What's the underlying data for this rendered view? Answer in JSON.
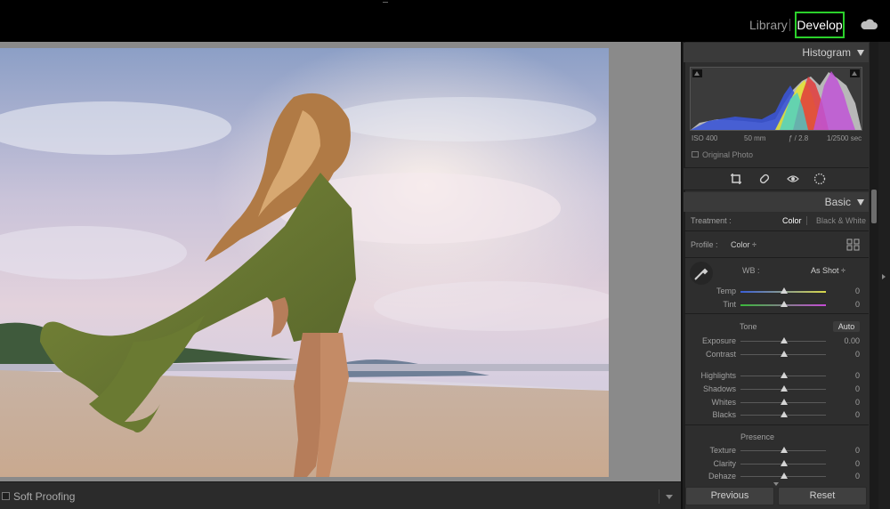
{
  "modules": {
    "library": "Library",
    "develop": "Develop"
  },
  "icons": {
    "cloud": "cloud-icon",
    "crop": "crop-overlay-icon",
    "heal": "healing-brush-icon",
    "redeye": "red-eye-icon",
    "masking": "masking-icon",
    "eyedropper": "eyedropper-icon",
    "profile_browser": "profile-browser-grid-icon"
  },
  "histogram": {
    "title": "Histogram",
    "iso": "ISO 400",
    "focal": "50 mm",
    "aperture": "ƒ / 2.8",
    "shutter": "1/2500 sec",
    "original_photo": "Original Photo"
  },
  "basic": {
    "title": "Basic",
    "treatment_label": "Treatment :",
    "treatment_color": "Color",
    "treatment_bw": "Black & White",
    "profile_label": "Profile :",
    "profile_value": "Color ÷",
    "wb_label": "WB :",
    "wb_value": "As Shot ÷",
    "temp_label": "Temp",
    "temp_value": "0",
    "tint_label": "Tint",
    "tint_value": "0",
    "tone_label": "Tone",
    "auto_label": "Auto",
    "exposure_label": "Exposure",
    "exposure_value": "0.00",
    "contrast_label": "Contrast",
    "contrast_value": "0",
    "highlights_label": "Highlights",
    "highlights_value": "0",
    "shadows_label": "Shadows",
    "shadows_value": "0",
    "whites_label": "Whites",
    "whites_value": "0",
    "blacks_label": "Blacks",
    "blacks_value": "0",
    "presence_label": "Presence",
    "texture_label": "Texture",
    "texture_value": "0",
    "clarity_label": "Clarity",
    "clarity_value": "0",
    "dehaze_label": "Dehaze",
    "dehaze_value": "0"
  },
  "buttons": {
    "previous": "Previous",
    "reset": "Reset"
  },
  "toolbar": {
    "soft_proofing": "Soft Proofing"
  },
  "colors": {
    "develop_highlight": "#2bd12b",
    "panel_bg": "#2e2e2e",
    "canvas_bg": "#8a8a8a"
  }
}
